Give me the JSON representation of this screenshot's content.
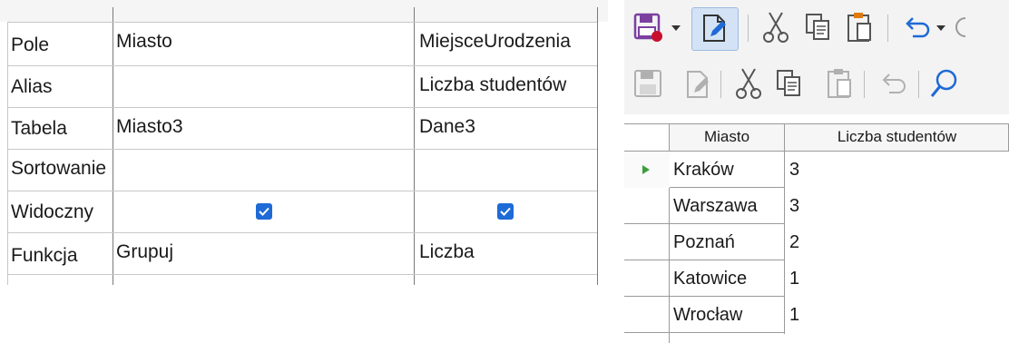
{
  "design_grid": {
    "row_labels": [
      "Pole",
      "Alias",
      "Tabela",
      "Sortowanie",
      "Widoczny",
      "Funkcja"
    ],
    "columns": [
      {
        "pole": "Miasto",
        "alias": "",
        "tabela": "Miasto3",
        "sortowanie": "",
        "widoczny": true,
        "funkcja": "Grupuj"
      },
      {
        "pole": "MiejsceUrodzenia",
        "alias": "Liczba studentów",
        "tabela": "Dane3",
        "sortowanie": "",
        "widoczny": true,
        "funkcja": "Liczba"
      }
    ]
  },
  "toolbar": {
    "row1": [
      "save-dropdown-icon",
      "edit-document-icon",
      "cut-icon",
      "copy-icon",
      "paste-icon",
      "undo-dropdown-icon"
    ],
    "row2": [
      "save-icon",
      "edit-document-icon",
      "cut-icon",
      "copy-icon",
      "paste-icon",
      "undo-icon",
      "find-icon"
    ],
    "active_item": "edit-document-icon"
  },
  "result_table": {
    "headers": [
      "Miasto",
      "Liczba studentów"
    ],
    "rows": [
      [
        "Kraków",
        "3"
      ],
      [
        "Warszawa",
        "3"
      ],
      [
        "Poznań",
        "2"
      ],
      [
        "Katowice",
        "1"
      ],
      [
        "Wrocław",
        "1"
      ]
    ],
    "current_row_index": 0
  },
  "colors": {
    "checkbox": "#1e6ad6",
    "highlight": "#d3e3f5",
    "save_icon_accent": "#c8102e",
    "save_icon_body": "#7b3fa0",
    "cursor": "#3a9d3a"
  }
}
